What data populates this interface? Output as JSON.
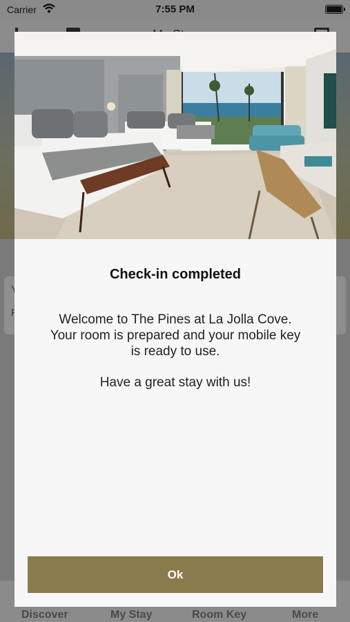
{
  "status_bar": {
    "carrier": "Carrier",
    "time": "7:55 PM",
    "battery_level": 1.0
  },
  "nav": {
    "title": "My Stay"
  },
  "background": {
    "card_line1": "Y",
    "card_line2": "P"
  },
  "modal": {
    "title": "Check-in completed",
    "message_line1": "Welcome to The Pines at La Jolla Cove.",
    "message_line2": "Your room is prepared and your mobile key",
    "message_line3": "is ready to use.",
    "message_line4": "Have a great stay with us!",
    "ok_label": "Ok",
    "accent_color": "#8a7b4c"
  },
  "tabs": [
    {
      "label": "Discover"
    },
    {
      "label": "My Stay"
    },
    {
      "label": "Room Key"
    },
    {
      "label": "More"
    }
  ]
}
